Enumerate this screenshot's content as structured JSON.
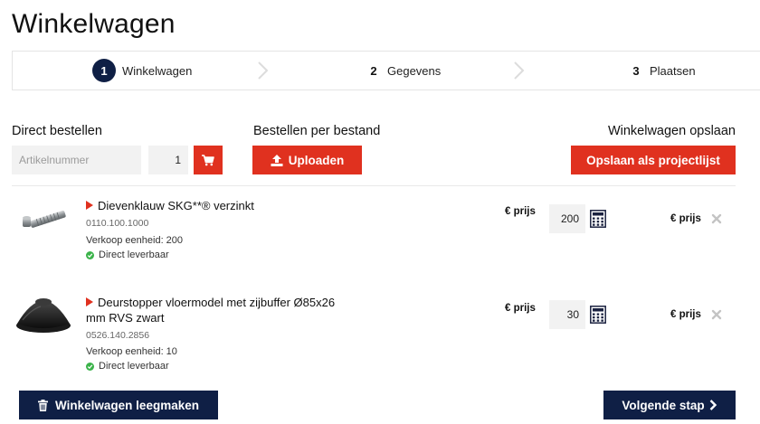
{
  "page": {
    "title": "Winkelwagen"
  },
  "steps": [
    {
      "number": "1",
      "label": "Winkelwagen"
    },
    {
      "number": "2",
      "label": "Gegevens"
    },
    {
      "number": "3",
      "label": "Plaatsen"
    }
  ],
  "direct_order": {
    "label": "Direct bestellen",
    "sku_placeholder": "Artikelnummer",
    "quantity": "1"
  },
  "file_order": {
    "label": "Bestellen per bestand",
    "upload_label": "Uploaden"
  },
  "save_cart": {
    "label": "Winkelwagen opslaan",
    "button_label": "Opslaan als projectlijst"
  },
  "items": [
    {
      "name": "Dievenklauw SKG**® verzinkt",
      "sku": "0110.100.1000",
      "unit": "Verkoop eenheid: 200",
      "stock": "Direct leverbaar",
      "unit_price": "€ prijs",
      "quantity": "200",
      "total_price": "€ prijs"
    },
    {
      "name": "Deurstopper vloermodel met zijbuffer Ø85x26",
      "name_line2": "mm RVS zwart",
      "sku": "0526.140.2856",
      "unit": "Verkoop eenheid: 10",
      "stock": "Direct leverbaar",
      "unit_price": "€ prijs",
      "quantity": "30",
      "total_price": "€ prijs"
    }
  ],
  "footer": {
    "clear_label": "Winkelwagen leegmaken",
    "next_label": "Volgende stap"
  },
  "colors": {
    "accent_red": "#e0311f",
    "navy": "#0f1f45",
    "stock_green": "#3bb34a"
  }
}
